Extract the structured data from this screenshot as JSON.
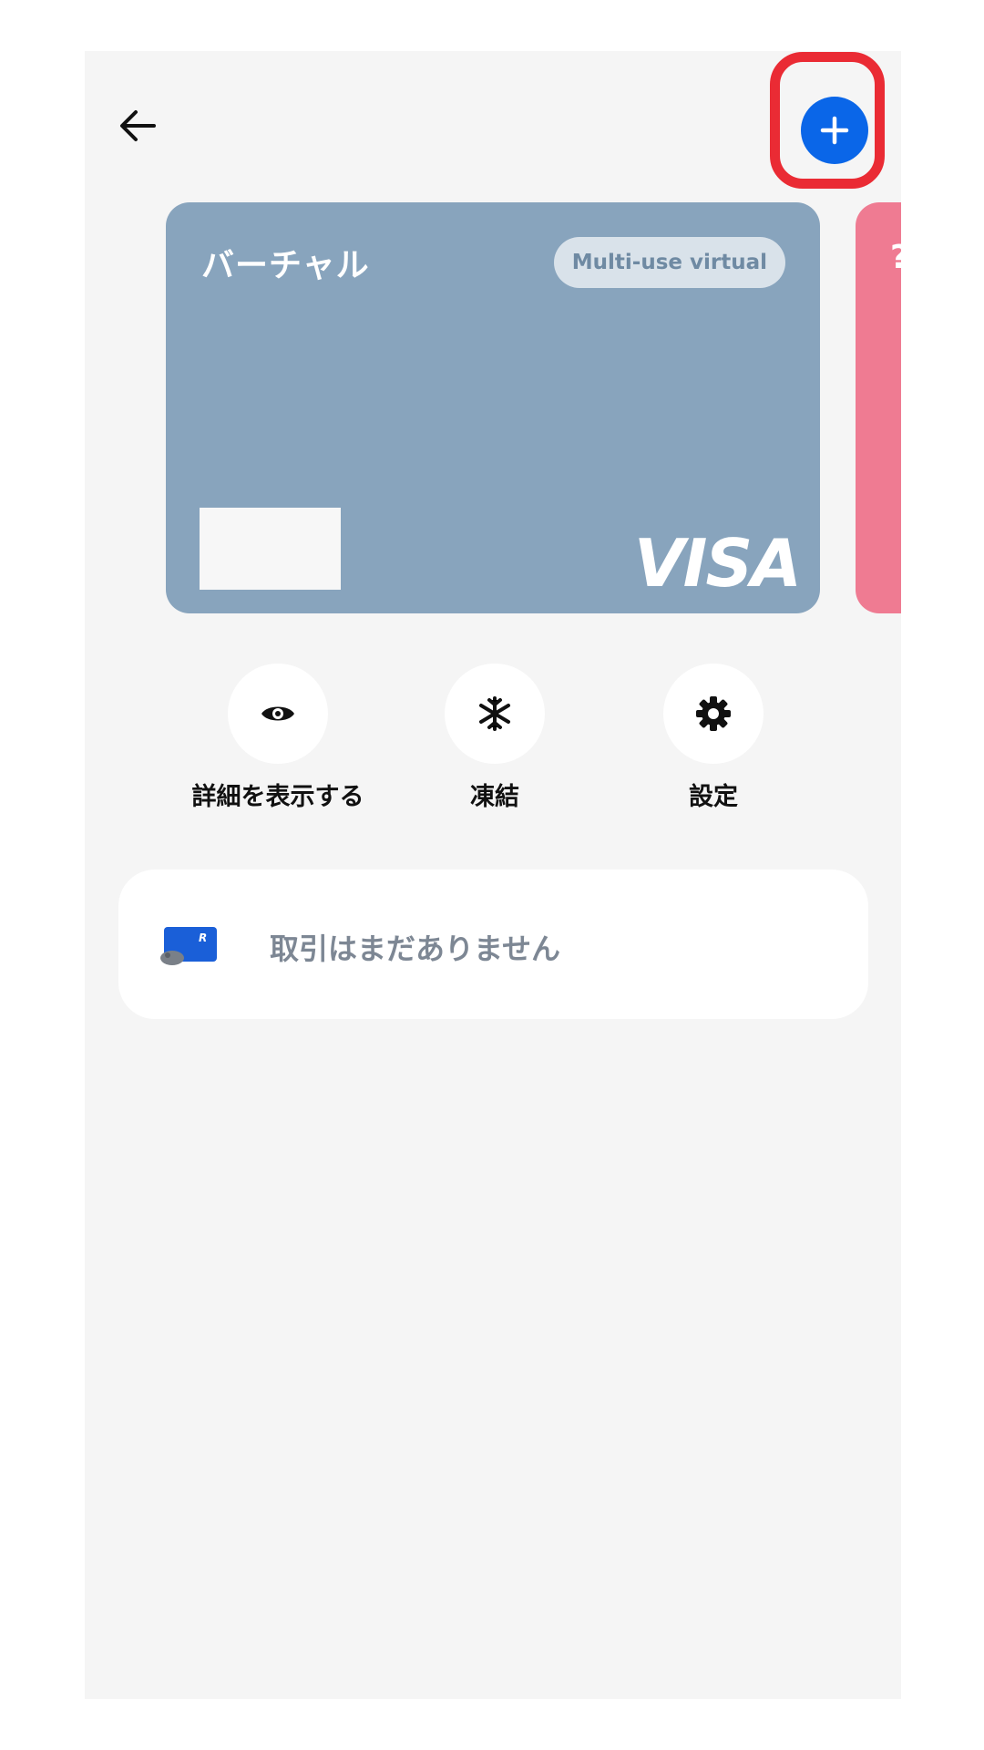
{
  "header": {
    "back_icon": "arrow-left-icon",
    "add_icon": "plus-icon",
    "add_button_color": "#0a66e8",
    "highlight_color": "#ea2b34"
  },
  "card": {
    "name": "バーチャル",
    "badge": "Multi-use virtual",
    "brand": "VISA",
    "color": "#88a4bd",
    "next_card_color": "#ef7b92",
    "next_card_glyph": "?"
  },
  "actions": [
    {
      "label": "詳細を表示する",
      "icon": "eye-icon"
    },
    {
      "label": "凍結",
      "icon": "snowflake-icon"
    },
    {
      "label": "設定",
      "icon": "gear-icon"
    }
  ],
  "transactions": {
    "empty_text": "取引はまだありません",
    "illustration": "card-illustration"
  }
}
